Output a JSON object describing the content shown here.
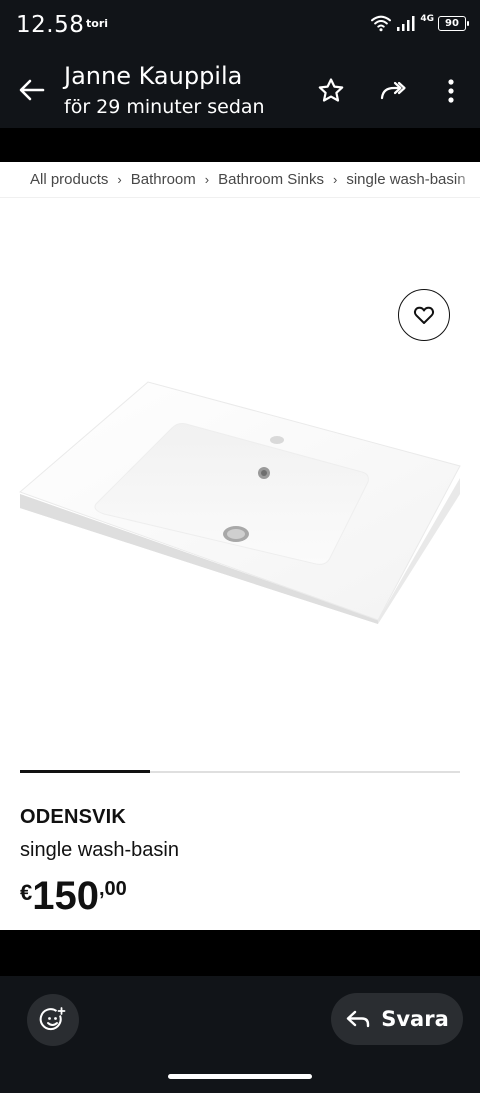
{
  "status_bar": {
    "time": "12.58",
    "carrier": "tori",
    "network": "4G",
    "battery": "90"
  },
  "app_bar": {
    "title": "Janne Kauppila",
    "subtitle": "för 29 minuter sedan",
    "icons": [
      "back-arrow-icon",
      "star-icon",
      "forward-icon",
      "more-vertical-icon"
    ]
  },
  "web_page": {
    "breadcrumb": [
      "All products",
      "Bathroom",
      "Bathroom Sinks",
      "single wash-basin"
    ],
    "breadcrumb_separator": "›",
    "favorite_icon": "heart-icon",
    "product": {
      "name": "ODENSVIK",
      "description": "single wash-basin",
      "price_currency": "€",
      "price_integer": "150",
      "price_decimal": ",00"
    }
  },
  "bottom_bar": {
    "emoji_icon": "emoji-add-icon",
    "reply_icon": "reply-icon",
    "reply_label": "Svara"
  },
  "colors": {
    "bar_background": "#111418",
    "button_background": "#2a2d31",
    "content_background": "#ffffff",
    "text_dark": "#111111"
  }
}
